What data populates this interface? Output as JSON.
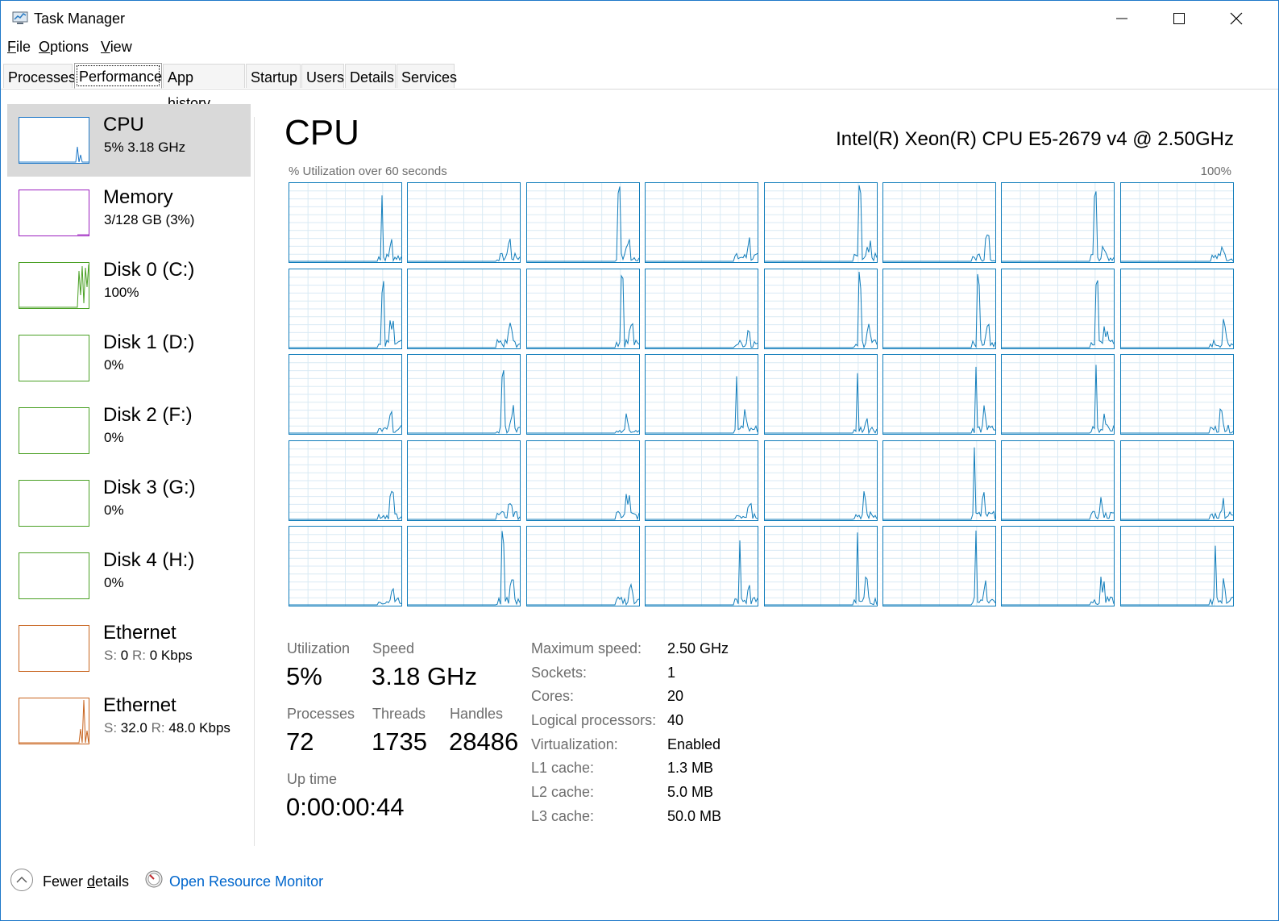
{
  "window": {
    "title": "Task Manager"
  },
  "menu": [
    {
      "accel": "F",
      "rest": "ile"
    },
    {
      "accel": "O",
      "rest": "ptions"
    },
    {
      "accel": "V",
      "rest": "iew"
    }
  ],
  "tabs": [
    {
      "label": "Processes",
      "active": false
    },
    {
      "label": "Performance",
      "active": true
    },
    {
      "label": "App history",
      "active": false
    },
    {
      "label": "Startup",
      "active": false
    },
    {
      "label": "Users",
      "active": false
    },
    {
      "label": "Details",
      "active": false
    },
    {
      "label": "Services",
      "active": false
    }
  ],
  "sidebar": {
    "items": [
      {
        "name": "CPU",
        "sub": "5%  3.18 GHz",
        "color": "#1e78c8",
        "selected": true
      },
      {
        "name": "Memory",
        "sub": "3/128 GB (3%)",
        "color": "#9b1fbf",
        "selected": false
      },
      {
        "name": "Disk 0 (C:)",
        "sub": "100%",
        "color": "#4aa024",
        "selected": false
      },
      {
        "name": "Disk 1 (D:)",
        "sub": "0%",
        "color": "#4aa024",
        "selected": false
      },
      {
        "name": "Disk 2 (F:)",
        "sub": "0%",
        "color": "#4aa024",
        "selected": false
      },
      {
        "name": "Disk 3 (G:)",
        "sub": "0%",
        "color": "#4aa024",
        "selected": false
      },
      {
        "name": "Disk 4 (H:)",
        "sub": "0%",
        "color": "#4aa024",
        "selected": false
      },
      {
        "name": "Ethernet",
        "sub_s_label": "S:",
        "sub_s": "0",
        "sub_r_label": "R:",
        "sub_r": "0 Kbps",
        "color": "#c8641e",
        "selected": false
      },
      {
        "name": "Ethernet",
        "sub_s_label": "S:",
        "sub_s": "32.0",
        "sub_r_label": "R:",
        "sub_r": "48.0 Kbps",
        "color": "#c8641e",
        "selected": false
      }
    ]
  },
  "main": {
    "title": "CPU",
    "cpu_model": "Intel(R) Xeon(R) CPU E5-2679 v4 @ 2.50GHz",
    "graph_caption": "% Utilization over 60 seconds",
    "graph_max": "100%",
    "logical_processor_count": 40,
    "graph_color": "#117dbb",
    "grid_line_color": "#d9eaf4"
  },
  "stats": {
    "utilization_label": "Utilization",
    "utilization": "5%",
    "speed_label": "Speed",
    "speed": "3.18 GHz",
    "processes_label": "Processes",
    "processes": "72",
    "threads_label": "Threads",
    "threads": "1735",
    "handles_label": "Handles",
    "handles": "28486",
    "uptime_label": "Up time",
    "uptime": "0:00:00:44"
  },
  "specs": [
    {
      "label": "Maximum speed:",
      "value": "2.50 GHz"
    },
    {
      "label": "Sockets:",
      "value": "1"
    },
    {
      "label": "Cores:",
      "value": "20"
    },
    {
      "label": "Logical processors:",
      "value": "40"
    },
    {
      "label": "Virtualization:",
      "value": "Enabled"
    },
    {
      "label": "L1 cache:",
      "value": "1.3 MB"
    },
    {
      "label": "L2 cache:",
      "value": "5.0 MB"
    },
    {
      "label": "L3 cache:",
      "value": "50.0 MB"
    }
  ],
  "footer": {
    "fewer_details_pre": "Fewer ",
    "fewer_details_accel": "d",
    "fewer_details_post": "etails",
    "resource_monitor": "Open Resource Monitor"
  }
}
